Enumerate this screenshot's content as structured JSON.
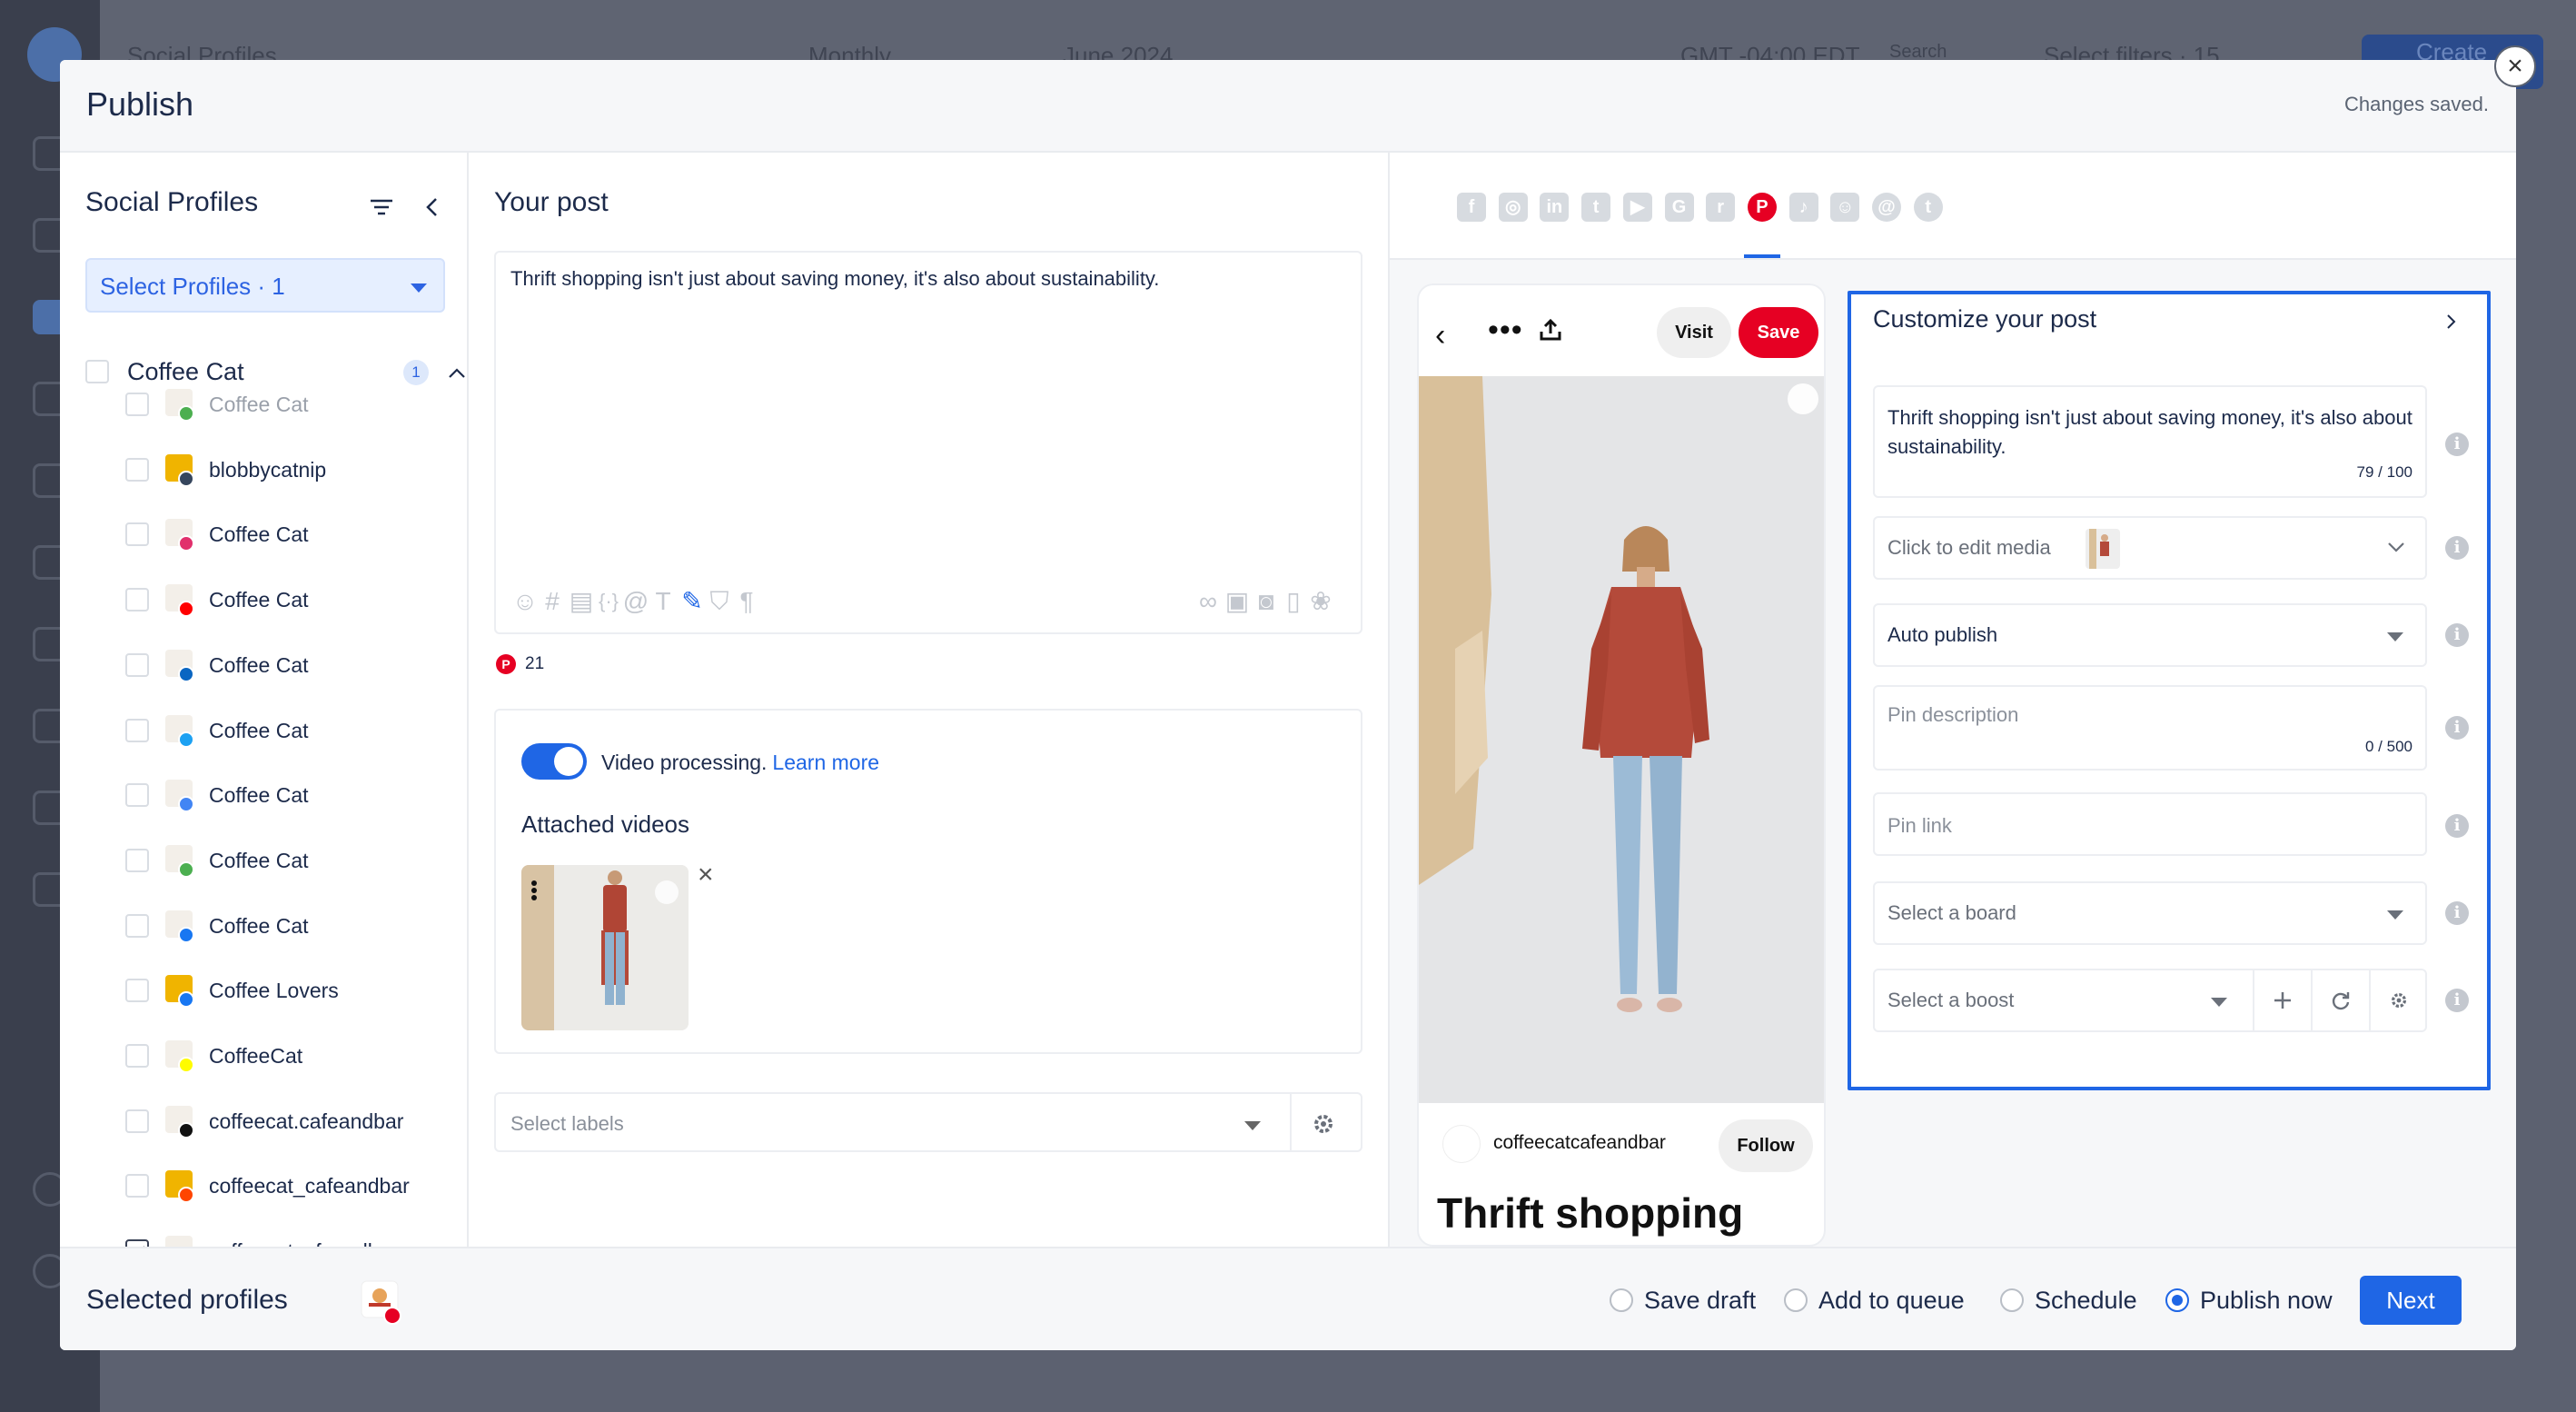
{
  "background": {
    "page_title": "Social Profiles",
    "period": "Monthly",
    "date": "June 2024",
    "timezone": "GMT -04:00 EDT",
    "search": "Search",
    "filters": "Select filters · 15",
    "create_label": "Create"
  },
  "modal": {
    "title": "Publish",
    "status": "Changes saved.",
    "close_icon": "close-icon"
  },
  "profiles_panel": {
    "title": "Social Profiles",
    "select_label": "Select Profiles · 1",
    "group": {
      "name": "Coffee Cat",
      "count": "1",
      "checked": false
    },
    "items": [
      {
        "name": "Coffee Cat",
        "network": "google-business",
        "checked": false,
        "dim": true
      },
      {
        "name": "blobbycatnip",
        "network": "tumblr",
        "checked": false
      },
      {
        "name": "Coffee Cat",
        "network": "instagram",
        "checked": false
      },
      {
        "name": "Coffee Cat",
        "network": "youtube",
        "checked": false
      },
      {
        "name": "Coffee Cat",
        "network": "linkedin",
        "checked": false
      },
      {
        "name": "Coffee Cat",
        "network": "twitter",
        "checked": false
      },
      {
        "name": "Coffee Cat",
        "network": "google",
        "checked": false
      },
      {
        "name": "Coffee Cat",
        "network": "google-business",
        "checked": false
      },
      {
        "name": "Coffee Cat",
        "network": "facebook",
        "checked": false
      },
      {
        "name": "Coffee Lovers",
        "network": "facebook",
        "checked": false
      },
      {
        "name": "CoffeeCat",
        "network": "snapchat",
        "checked": false
      },
      {
        "name": "coffeecat.cafeandbar",
        "network": "tiktok",
        "checked": false
      },
      {
        "name": "coffeecat_cafeandbar",
        "network": "reddit",
        "checked": false
      },
      {
        "name": "coffeecatcafeandbar",
        "network": "pinterest",
        "checked": true
      }
    ]
  },
  "post": {
    "title": "Your post",
    "text": "Thrift shopping isn't just about saving money, it's also about sustainability.",
    "pinterest_count": "21",
    "video_processing_label": "Video processing.",
    "learn_more": "Learn more",
    "attached_title": "Attached videos",
    "labels_placeholder": "Select labels"
  },
  "networks": [
    "facebook",
    "instagram",
    "linkedin",
    "twitter",
    "youtube",
    "google",
    "reddit",
    "pinterest",
    "tiktok",
    "snapchat",
    "threads",
    "tumblr"
  ],
  "preview": {
    "visit": "Visit",
    "save": "Save",
    "author": "coffeecatcafeandbar",
    "follow": "Follow",
    "title": "Thrift shopping"
  },
  "customize": {
    "title": "Customize your post",
    "text": "Thrift shopping isn't just about saving money, it's also about sustainability.",
    "text_count": "79 / 100",
    "media_label": "Click to edit media",
    "publish_mode": "Auto publish",
    "pin_description_placeholder": "Pin description",
    "pin_description_count": "0 / 500",
    "pin_link_placeholder": "Pin link",
    "board_placeholder": "Select a board",
    "boost_placeholder": "Select a boost"
  },
  "footer": {
    "selected_label": "Selected profiles",
    "options": [
      {
        "label": "Save draft",
        "selected": false
      },
      {
        "label": "Add to queue",
        "selected": false
      },
      {
        "label": "Schedule",
        "selected": false
      },
      {
        "label": "Publish now",
        "selected": true
      }
    ],
    "next_label": "Next"
  },
  "colors": {
    "accent": "#1f66e5",
    "pinterest": "#e60023",
    "text": "#1c2a4a"
  }
}
